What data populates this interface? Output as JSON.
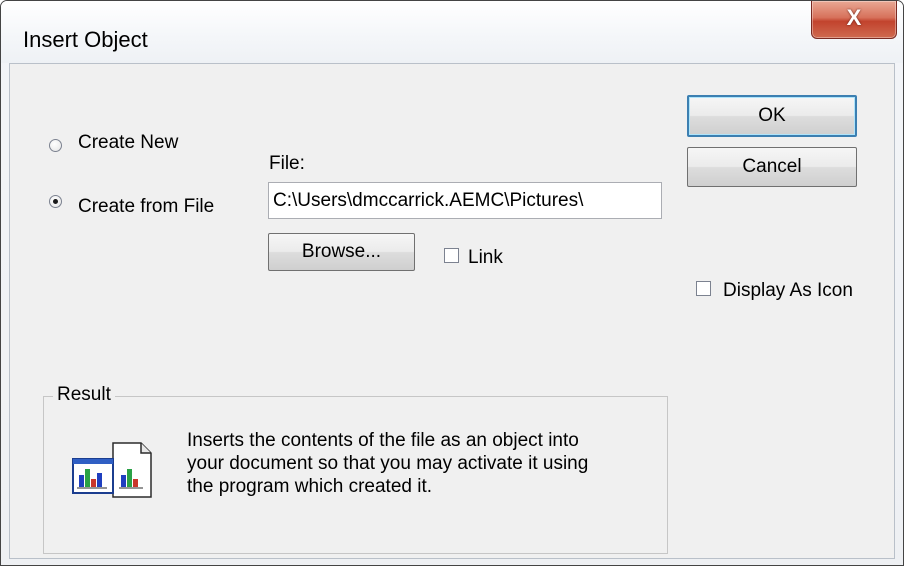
{
  "window": {
    "title": "Insert Object",
    "close_glyph": "X"
  },
  "options": {
    "create_new_label": "Create New",
    "create_from_file_label": "Create from File",
    "selected": "create_from_file"
  },
  "file": {
    "label": "File:",
    "value": "C:\\Users\\dmccarrick.AEMC\\Pictures\\",
    "browse_label": "Browse...",
    "link_label": "Link",
    "link_checked": false
  },
  "buttons": {
    "ok_label": "OK",
    "cancel_label": "Cancel"
  },
  "display_as_icon": {
    "label": "Display As Icon",
    "checked": false
  },
  "result": {
    "group_label": "Result",
    "lines": [
      "Inserts the contents of the file as an object into",
      "your document so that you may activate it using",
      "the program which created it."
    ],
    "icon": "insert-file-object-icon"
  }
}
